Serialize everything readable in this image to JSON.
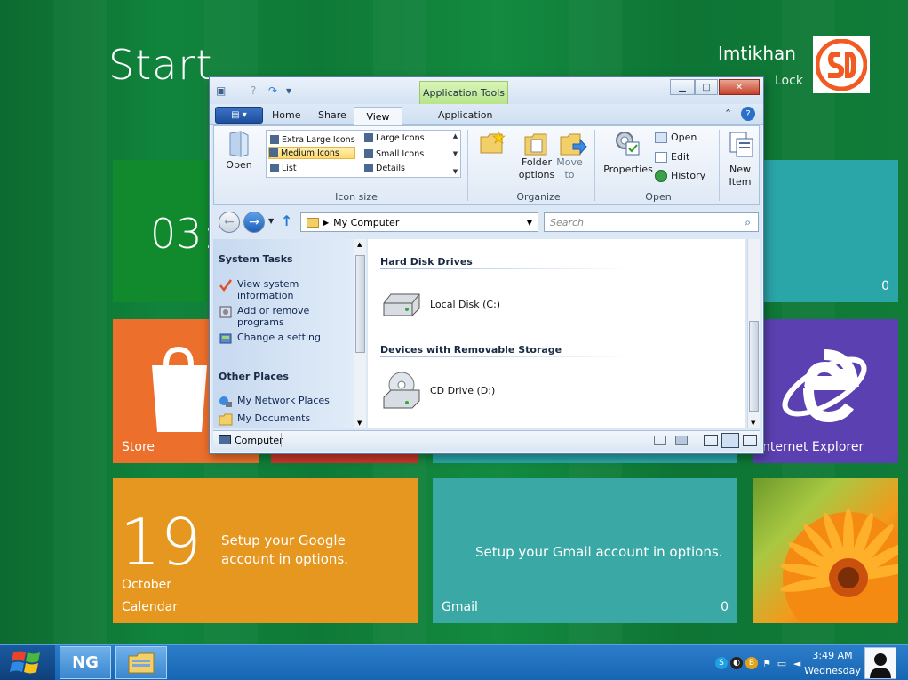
{
  "start": {
    "title": "Start",
    "user_name": "Imtikhan",
    "lock_label": "Lock"
  },
  "tiles": {
    "clock_tile": {
      "time": "03:"
    },
    "weather_tile": {
      "count": "0"
    },
    "store": {
      "label": "Store"
    },
    "ie": {
      "label": "nternet Explorer"
    },
    "calendar": {
      "day": "19",
      "month": "October",
      "label": "Calendar",
      "message": "Setup your Google account in options."
    },
    "gmail": {
      "message": "Setup your Gmail account in options.",
      "label": "Gmail",
      "count": "0"
    }
  },
  "explorer": {
    "app_tools_tab": "Application Tools",
    "tabs": {
      "home": "Home",
      "share": "Share",
      "view": "View",
      "application": "Application"
    },
    "ribbon": {
      "open_label": "Open",
      "layouts": {
        "extra_large": "Extra Large Icons",
        "large": "Large Icons",
        "medium": "Medium Icons",
        "small": "Small Icons",
        "list": "List",
        "details": "Details"
      },
      "icon_size_group": "Icon size",
      "folder_options": "Folder options",
      "move_to": "Move to",
      "organize_group": "Organize",
      "properties": "Properties",
      "open_menu": "Open",
      "edit": "Edit",
      "history": "History",
      "open_group": "Open",
      "new_item": "New Item"
    },
    "address": {
      "path": "My Computer",
      "search_placeholder": "Search"
    },
    "task_pane": {
      "system_tasks_head": "System Tasks",
      "view_system_info": "View system information",
      "add_remove": "Add or remove programs",
      "change_setting": "Change a setting",
      "other_places_head": "Other Places",
      "network_places": "My Network Places",
      "my_documents": "My Documents"
    },
    "content": {
      "hdd_head": "Hard Disk Drives",
      "local_disk": "Local Disk (C:)",
      "removable_head": "Devices with Removable Storage",
      "cd_drive": "CD Drive (D:)"
    },
    "status": {
      "location": "Computer"
    }
  },
  "taskbar": {
    "clock_time": "3:49 AM",
    "clock_day": "Wednesday"
  },
  "colors": {
    "bg_green": "#10843c",
    "tile_green": "#0f8a2e",
    "tile_teal": "#2aa5a8",
    "tile_orange": "#ec6f2b",
    "tile_red": "#c8362a",
    "tile_purple": "#5a40b0",
    "tile_amber": "#e5971f",
    "tile_teal_light": "#3aa9a5",
    "taskbar_blue": "#2c7dc9"
  }
}
